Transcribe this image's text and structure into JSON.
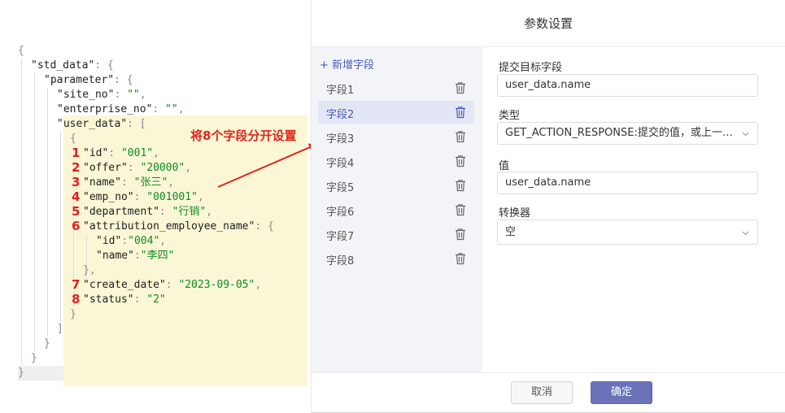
{
  "code": {
    "lines": [
      "{",
      "\"std_data\": {",
      "\"parameter\": {",
      "\"site_no\": \"\",",
      "\"enterprise_no\": \"\",",
      "\"user_data\": [",
      "{",
      "\"id\": \"001\",",
      "\"offer\": \"20000\",",
      "\"name\": \"张三\",",
      "\"emp_no\": \"001001\",",
      "\"department\": \"行销\",",
      "\"attribution_employee_name\": {",
      "\"id\":\"004\",",
      "\"name\":\"李四\"",
      "},",
      "\"create_date\": \"2023-09-05\",",
      "\"status\": \"2\"",
      "}",
      "]",
      "}",
      "}",
      "}"
    ],
    "markers": [
      "1",
      "2",
      "3",
      "4",
      "5",
      "6",
      "7",
      "8"
    ]
  },
  "annotation": "将8个字段分开设置",
  "dialog": {
    "title": "参数设置",
    "add_field_label": "+ 新增字段",
    "fields": [
      "字段1",
      "字段2",
      "字段3",
      "字段4",
      "字段5",
      "字段6",
      "字段7",
      "字段8"
    ],
    "selected_field": "字段2",
    "form": {
      "target_label": "提交目标字段",
      "target_value": "user_data.name",
      "type_label": "类型",
      "type_value": "GET_ACTION_RESPONSE:提交的值，或上一个ac...",
      "value_label": "值",
      "value_value": "user_data.name",
      "converter_label": "转换器",
      "converter_value": "空"
    },
    "cancel_label": "取消",
    "ok_label": "确定"
  },
  "colors": {
    "accent": "#6a72b8",
    "highlight": "#fbf7d6",
    "annotation": "#e0261c",
    "json_string": "#0f8a22"
  },
  "icons": [
    "trash-icon",
    "chevron-down-icon",
    "arrow-icon"
  ]
}
